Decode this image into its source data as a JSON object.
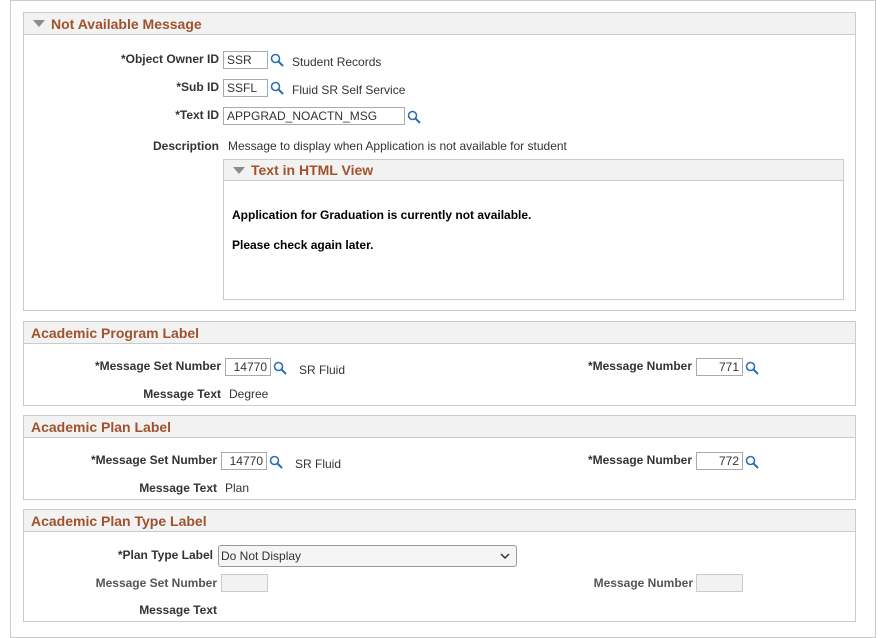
{
  "not_available": {
    "title": "Not Available Message",
    "object_owner_label": "*Object Owner ID",
    "object_owner_value": "SSR",
    "object_owner_desc": "Student Records",
    "sub_id_label": "*Sub ID",
    "sub_id_value": "SSFL",
    "sub_id_desc": "Fluid SR Self Service",
    "text_id_label": "*Text ID",
    "text_id_value": "APPGRAD_NOACTN_MSG",
    "description_label": "Description",
    "description_value": "Message to display when Application is not available for student",
    "html_view_title": "Text in HTML View",
    "html_line1": "Application for Graduation is currently not available.",
    "html_line2": "Please check again later."
  },
  "program_label": {
    "title": "Academic Program Label",
    "msg_set_label": "*Message Set Number",
    "msg_set_value": "14770",
    "msg_set_desc": "SR Fluid",
    "msg_num_label": "*Message Number",
    "msg_num_value": "771",
    "msg_text_label": "Message Text",
    "msg_text_value": "Degree"
  },
  "plan_label": {
    "title": "Academic Plan Label",
    "msg_set_label": "*Message Set Number",
    "msg_set_value": "14770",
    "msg_set_desc": "SR Fluid",
    "msg_num_label": "*Message Number",
    "msg_num_value": "772",
    "msg_text_label": "Message Text",
    "msg_text_value": "Plan"
  },
  "plan_type_label": {
    "title": "Academic Plan Type Label",
    "plan_type_label": "*Plan Type Label",
    "plan_type_value": "Do Not Display",
    "msg_set_label": "Message Set Number",
    "msg_num_label": "Message Number",
    "msg_text_label": "Message Text"
  },
  "colors": {
    "header_text": "#a0522d",
    "header_bg": "#f2f2f2",
    "border": "#cbcbcb"
  },
  "icons": {
    "lookup": "magnifier-icon",
    "collapse": "triangle-down-icon",
    "dropdown": "chevron-down-icon"
  }
}
